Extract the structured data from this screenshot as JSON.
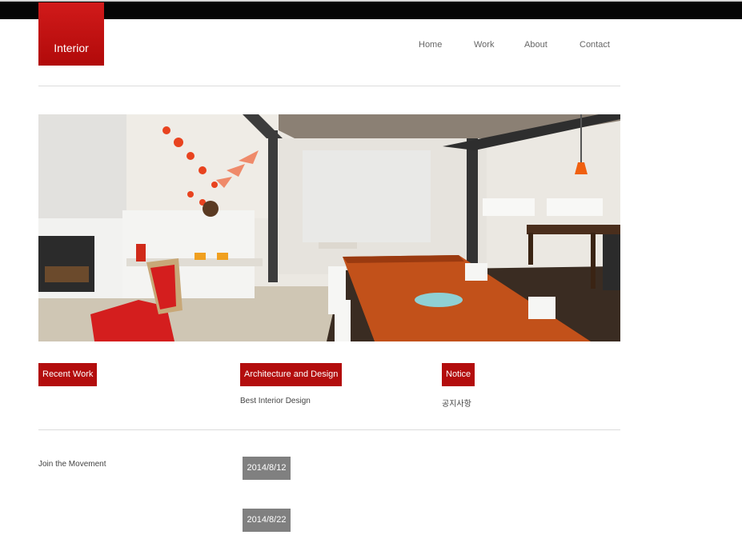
{
  "header": {
    "logo_text": "Interior",
    "nav": [
      "Home",
      "Work",
      "About",
      "Contact"
    ]
  },
  "hero": {
    "image": "interior-dining-room-photo"
  },
  "sections": [
    {
      "title": "Recent Work",
      "text": ""
    },
    {
      "title": "Architecture and Design",
      "text": "Best Interior Design"
    },
    {
      "title": "Notice",
      "text": "공지사항"
    }
  ],
  "feed": {
    "headline": "Join the Movement",
    "dates": [
      "2014/8/12",
      "2014/8/22"
    ]
  },
  "colors": {
    "accent": "#b30d0d",
    "topbar": "#050505",
    "date_box": "#808080"
  }
}
